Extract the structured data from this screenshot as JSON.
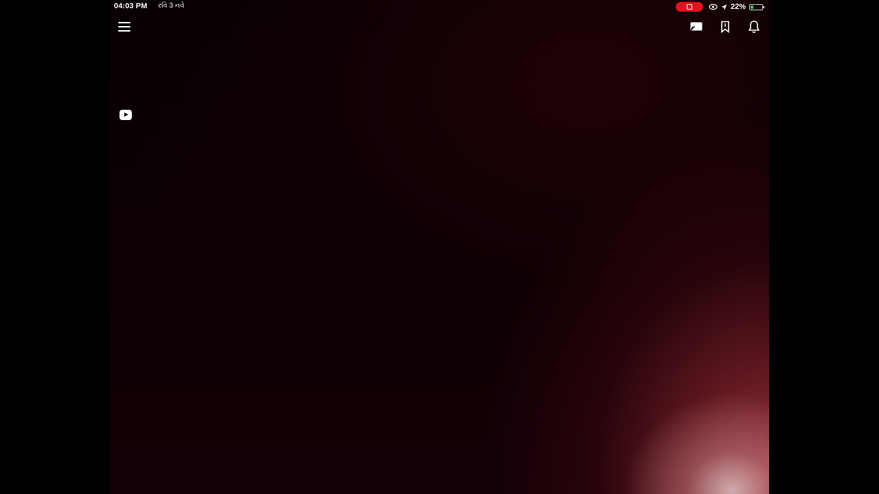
{
  "status_bar": {
    "time": "04:03 PM",
    "date": "રવિ 3 નવે",
    "battery_percent_label": "22%",
    "battery_level": 0.22,
    "recording_color": "#e0141e",
    "icons": [
      "screen-record-icon",
      "eye-comfort-icon",
      "location-icon",
      "battery-icon"
    ]
  },
  "header": {
    "menu_icon": "hamburger-menu-icon",
    "actions": [
      "cast-icon",
      "bookmark-icon",
      "notifications-bell-icon"
    ]
  },
  "player": {
    "badge_icon": "youtube-icon",
    "glow_color": "#a0373f"
  }
}
